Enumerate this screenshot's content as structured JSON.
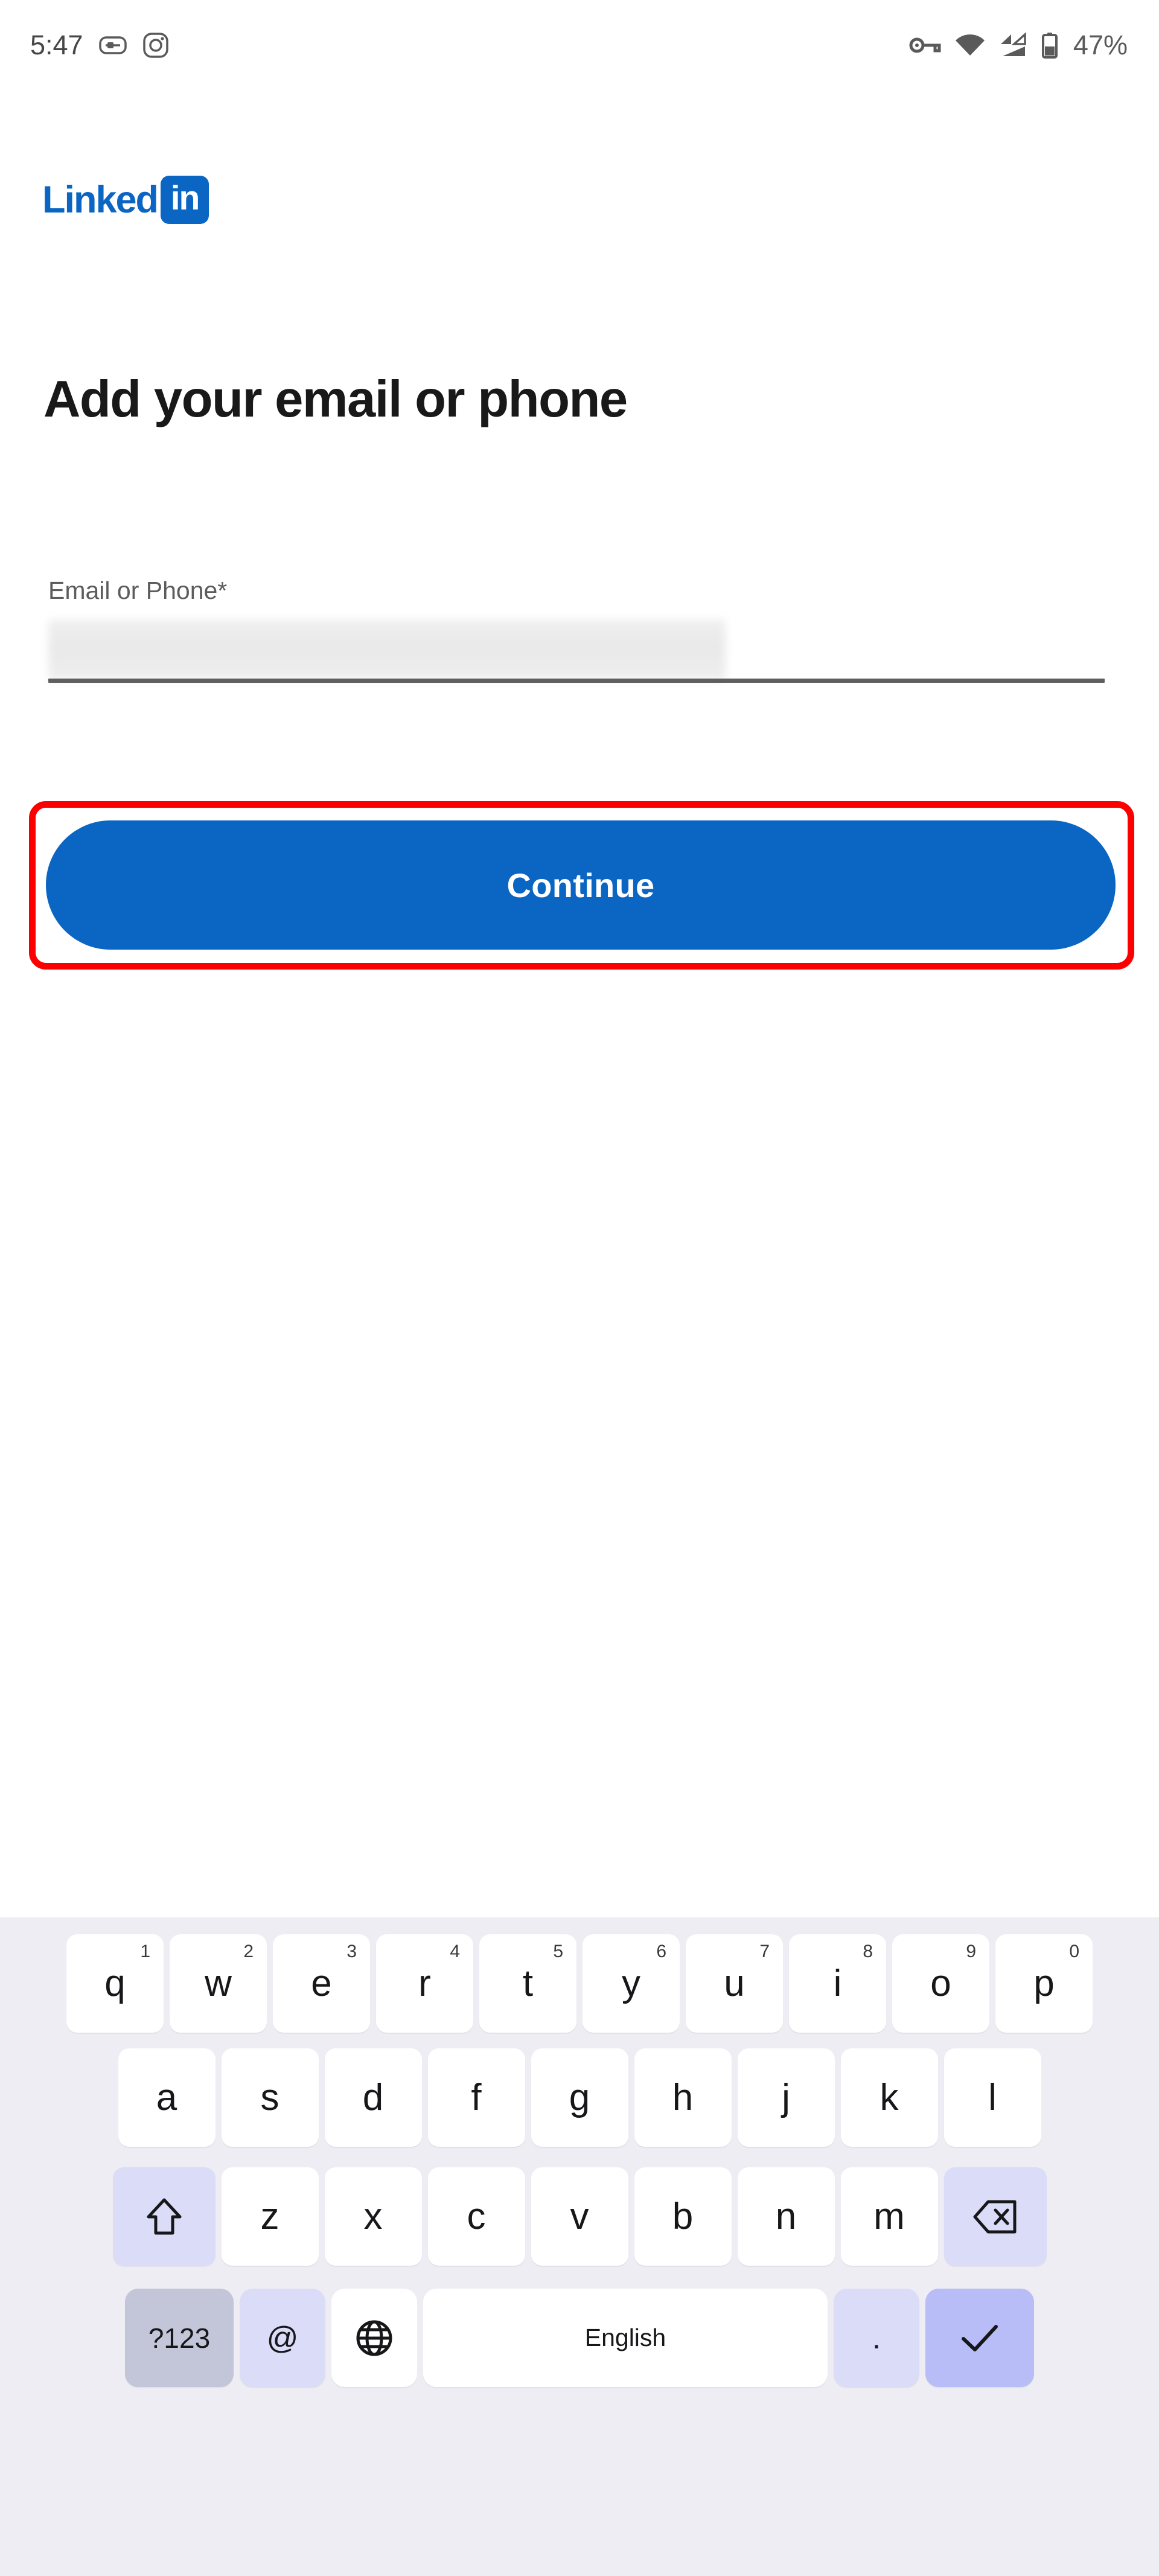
{
  "status_bar": {
    "time": "5:47",
    "left_icons": [
      "sim-card-icon",
      "instagram-icon"
    ],
    "right_icons": [
      "vpn-key-icon",
      "wifi-icon",
      "cellular-signal-icon",
      "battery-icon"
    ],
    "battery_percent": "47%"
  },
  "brand": {
    "logo_word": "Linked",
    "logo_badge": "in",
    "logo_color": "#0a66c2"
  },
  "main": {
    "title": "Add your email or phone",
    "field": {
      "label": "Email or Phone*",
      "value": "",
      "placeholder": "",
      "redacted": true
    },
    "primary_button": {
      "label": "Continue",
      "color": "#0a66c2",
      "text_color": "#ffffff"
    },
    "highlight": {
      "color": "#fb0000",
      "target": "Continue"
    }
  },
  "keyboard": {
    "background": "#eeedf3",
    "row1": [
      {
        "key": "q",
        "sup": "1"
      },
      {
        "key": "w",
        "sup": "2"
      },
      {
        "key": "e",
        "sup": "3"
      },
      {
        "key": "r",
        "sup": "4"
      },
      {
        "key": "t",
        "sup": "5"
      },
      {
        "key": "y",
        "sup": "6"
      },
      {
        "key": "u",
        "sup": "7"
      },
      {
        "key": "i",
        "sup": "8"
      },
      {
        "key": "o",
        "sup": "9"
      },
      {
        "key": "p",
        "sup": "0"
      }
    ],
    "row2": [
      {
        "key": "a"
      },
      {
        "key": "s"
      },
      {
        "key": "d"
      },
      {
        "key": "f"
      },
      {
        "key": "g"
      },
      {
        "key": "h"
      },
      {
        "key": "j"
      },
      {
        "key": "k"
      },
      {
        "key": "l"
      }
    ],
    "row3": [
      {
        "key": "z"
      },
      {
        "key": "x"
      },
      {
        "key": "c"
      },
      {
        "key": "v"
      },
      {
        "key": "b"
      },
      {
        "key": "n"
      },
      {
        "key": "m"
      }
    ],
    "shift_icon": "shift-arrow-icon",
    "backspace_icon": "backspace-icon",
    "row4": {
      "symbols_label": "?123",
      "at_label": "@",
      "globe_icon": "globe-icon",
      "space_label": "English",
      "period_label": ".",
      "enter_icon": "checkmark-icon"
    }
  }
}
